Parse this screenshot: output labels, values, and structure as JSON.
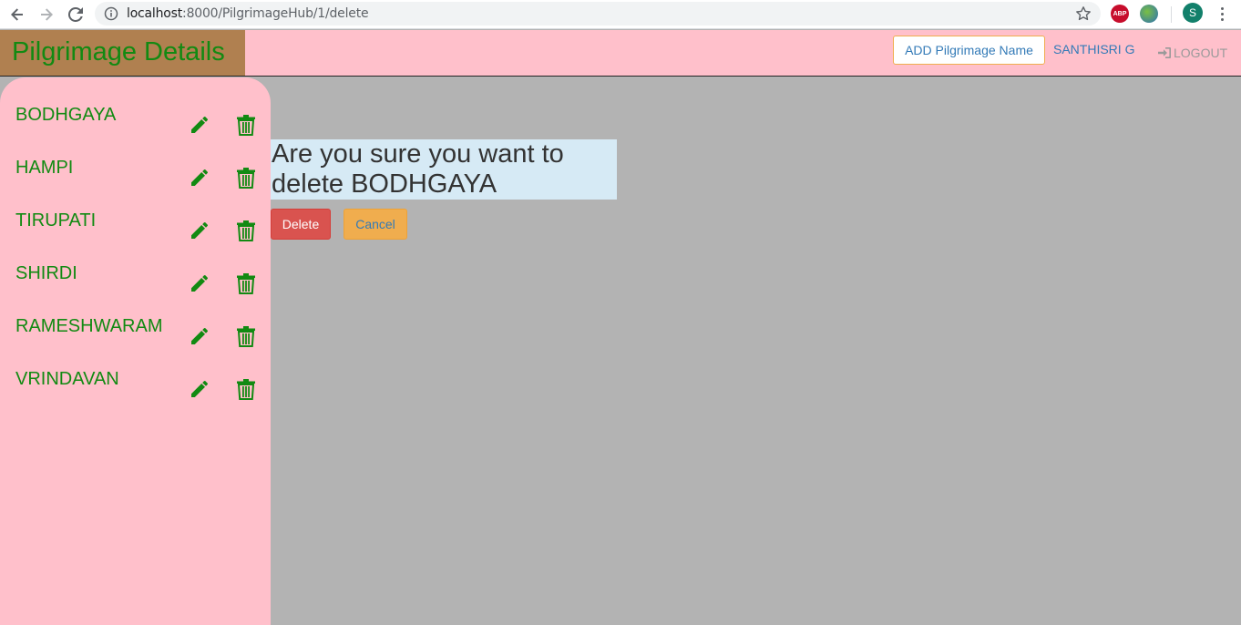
{
  "browser": {
    "url_host": "localhost",
    "url_path": ":8000/PilgrimageHub/1/delete",
    "abp_label": "ABP",
    "profile_initial": "S"
  },
  "header": {
    "title": "Pilgrimage Details",
    "add_button_label": "ADD Pilgrimage Name",
    "user_name": "SANTHISRI G",
    "logout_label": "LOGOUT"
  },
  "sidebar": {
    "items": [
      {
        "label": "BODHGAYA"
      },
      {
        "label": "HAMPI"
      },
      {
        "label": "TIRUPATI"
      },
      {
        "label": "SHIRDI"
      },
      {
        "label": "RAMESHWARAM"
      },
      {
        "label": "VRINDAVAN"
      }
    ]
  },
  "main": {
    "confirm_message": "Are you sure you want to delete BODHGAYA",
    "delete_label": "Delete",
    "cancel_label": "Cancel"
  },
  "colors": {
    "header_bg": "#ffc0cb",
    "brand_bg": "#b08050",
    "brand_text": "#128a12",
    "content_bg": "#b3b3b3",
    "delete_bg": "#d9534f",
    "cancel_bg": "#f0ad4e"
  },
  "icons": {
    "edit": "pencil-icon",
    "delete": "trash-icon",
    "logout": "sign-in-icon"
  }
}
